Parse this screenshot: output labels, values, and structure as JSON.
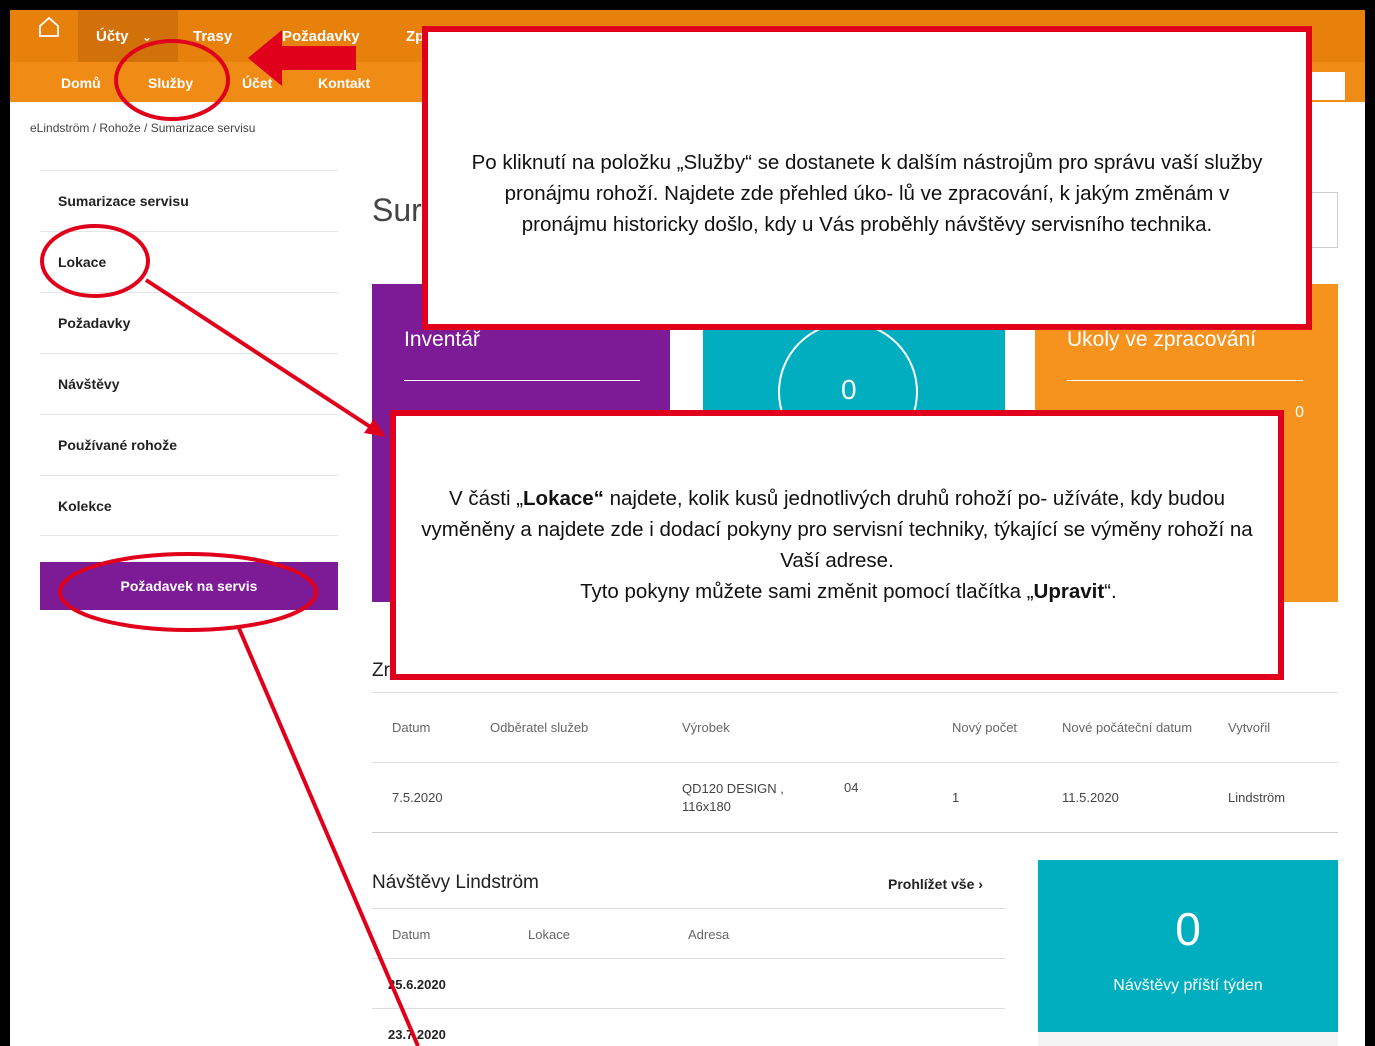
{
  "top_nav": {
    "items": [
      "Účty",
      "Trasy",
      "Požadavky",
      "Zp"
    ],
    "home_icon": "home-icon"
  },
  "sub_nav": {
    "items": [
      "Domů",
      "Služby",
      "Účet",
      "Kontakt"
    ]
  },
  "breadcrumb": "eLindström / Rohože / Sumarizace servisu",
  "sidebar": {
    "items": [
      "Sumarizace servisu",
      "Lokace",
      "Požadavky",
      "Návštěvy",
      "Používané rohože",
      "Kolekce"
    ],
    "button": "Požadavek na servis"
  },
  "page_title": "Sur",
  "cards": {
    "purple_title": "Inventář",
    "teal_value": "0",
    "orange_title": "Úkoly ve zpracování",
    "orange_value": "0"
  },
  "changes": {
    "title": "Zr",
    "headers": [
      "Datum",
      "Odběratel služeb",
      "Výrobek",
      "",
      "Nový počet",
      "Nové počáteční datum",
      "Vytvořil"
    ],
    "row": [
      "7.5.2020",
      "",
      "QD120 DESIGN , 116x180",
      "04",
      "1",
      "11.5.2020",
      "Lindström"
    ]
  },
  "visits": {
    "title": "Návštěvy Lindström",
    "link": "Prohlížet vše ›",
    "headers": [
      "Datum",
      "Lokace",
      "Adresa"
    ],
    "dates": [
      "25.6.2020",
      "23.7.2020"
    ]
  },
  "next_week": {
    "value": "0",
    "label": "Návštěvy příští týden"
  },
  "callouts": {
    "one": "Po kliknutí na položku „Služby“ se dostanete k dalším nástrojům pro správu vaší služby pronájmu rohoží. Najdete zde přehled úko- lů ve zpracování, k jakým změnám v pronájmu historicky došlo, kdy u Vás proběhly návštěvy servisního technika.",
    "two_a": "V části „",
    "two_b": "Lokace“",
    "two_c": " najdete, kolik kusů jednotlivých druhů rohoží po- užíváte, kdy budou vyměněny a najdete zde i dodací pokyny pro servisní techniky, týkající se výměny rohoží na Vaší adrese.",
    "two_d": "Tyto pokyny můžete sami změnit pomocí tlačítka „",
    "two_e": "Upravit",
    "two_f": "“."
  },
  "colors": {
    "orange_nav": "#e8810c",
    "purple": "#7d1b96",
    "teal": "#00aebf",
    "orange_card": "#f6921e",
    "annotation_red": "#e0001b"
  }
}
